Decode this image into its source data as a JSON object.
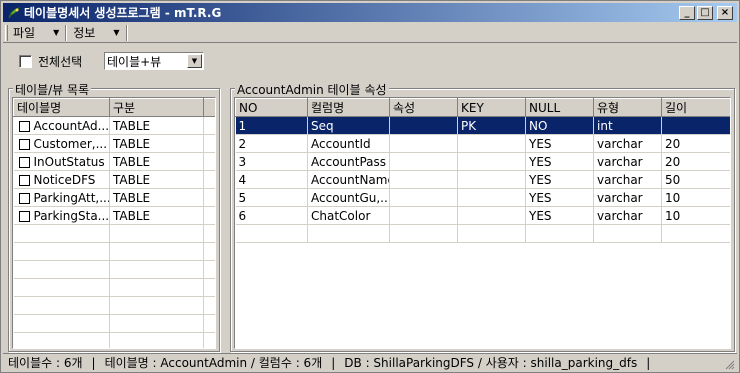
{
  "window": {
    "title": "테이블명세서 생성프로그램 - mT.R.G",
    "minimize_label": "_",
    "maximize_label": "□",
    "close_label": "×"
  },
  "menu": {
    "items": [
      {
        "label": "파일"
      },
      {
        "label": "정보"
      }
    ]
  },
  "toolbar": {
    "select_all_label": "전체선택",
    "select_all_checked": false,
    "filter_value": "테이블+뷰"
  },
  "left_panel": {
    "legend": "테이블/뷰 목록",
    "columns": [
      "테이블명",
      "구분"
    ],
    "rows": [
      {
        "name": "AccountAd...",
        "type": "TABLE"
      },
      {
        "name": "Customer,...",
        "type": "TABLE"
      },
      {
        "name": "InOutStatus",
        "type": "TABLE"
      },
      {
        "name": "NoticeDFS",
        "type": "TABLE"
      },
      {
        "name": "ParkingAtt,...",
        "type": "TABLE"
      },
      {
        "name": "ParkingSta...",
        "type": "TABLE"
      }
    ]
  },
  "right_panel": {
    "legend": "AccountAdmin 테이블 속성",
    "columns": [
      "NO",
      "컬럼명",
      "속성",
      "KEY",
      "NULL",
      "유형",
      "길이"
    ],
    "rows": [
      [
        "1",
        "Seq",
        "",
        "PK",
        "NO",
        "int",
        ""
      ],
      [
        "2",
        "AccountId",
        "",
        "",
        "YES",
        "varchar",
        "20"
      ],
      [
        "3",
        "AccountPass",
        "",
        "",
        "YES",
        "varchar",
        "20"
      ],
      [
        "4",
        "AccountName",
        "",
        "",
        "YES",
        "varchar",
        "50"
      ],
      [
        "5",
        "AccountGu,...",
        "",
        "",
        "YES",
        "varchar",
        "10"
      ],
      [
        "6",
        "ChatColor",
        "",
        "",
        "YES",
        "varchar",
        "10"
      ]
    ],
    "selected_row": 0
  },
  "status": {
    "table_count": "테이블수 : 6개",
    "table_info": "테이블명 : AccountAdmin / 컬럼수 : 6개",
    "db_info": "DB : ShillaParkingDFS / 사용자 : shilla_parking_dfs",
    "separator": "|"
  },
  "colors": {
    "selection": "#0a246a",
    "face": "#d4d0c8"
  }
}
